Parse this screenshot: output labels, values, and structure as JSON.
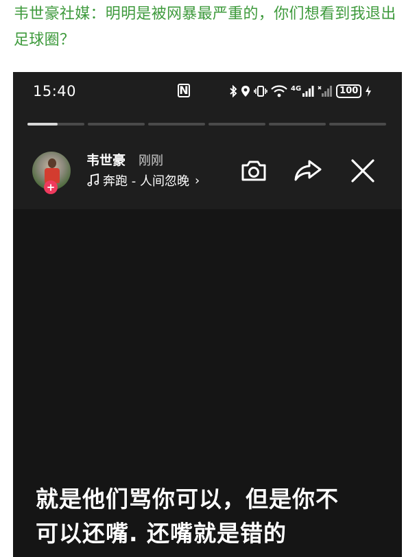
{
  "article": {
    "headline": "韦世豪社媒：明明是被网暴最严重的，你们想看到我退出足球圈？"
  },
  "status_bar": {
    "time": "15:40",
    "nfc_label": "N",
    "network": "4G",
    "battery": "100"
  },
  "story": {
    "progress_fill": [
      0.53,
      0,
      0,
      0,
      0,
      0
    ],
    "username": "韦世豪",
    "posted": "刚刚",
    "music": "奔跑 - 人间忽晚",
    "caption_line1": "就是他们骂你可以，但是你不",
    "caption_line2": "可以还嘴. 还嘴就是错的"
  },
  "icons": [
    "music-note-icon",
    "camera-icon",
    "share-icon",
    "close-icon",
    "bluetooth-icon",
    "location-icon",
    "vibrate-icon",
    "wifi-icon",
    "signal-icon",
    "charging-icon"
  ],
  "colors": {
    "headline": "#3e9a3c",
    "plus_badge": "#ef3a5d",
    "background": "#151515"
  }
}
